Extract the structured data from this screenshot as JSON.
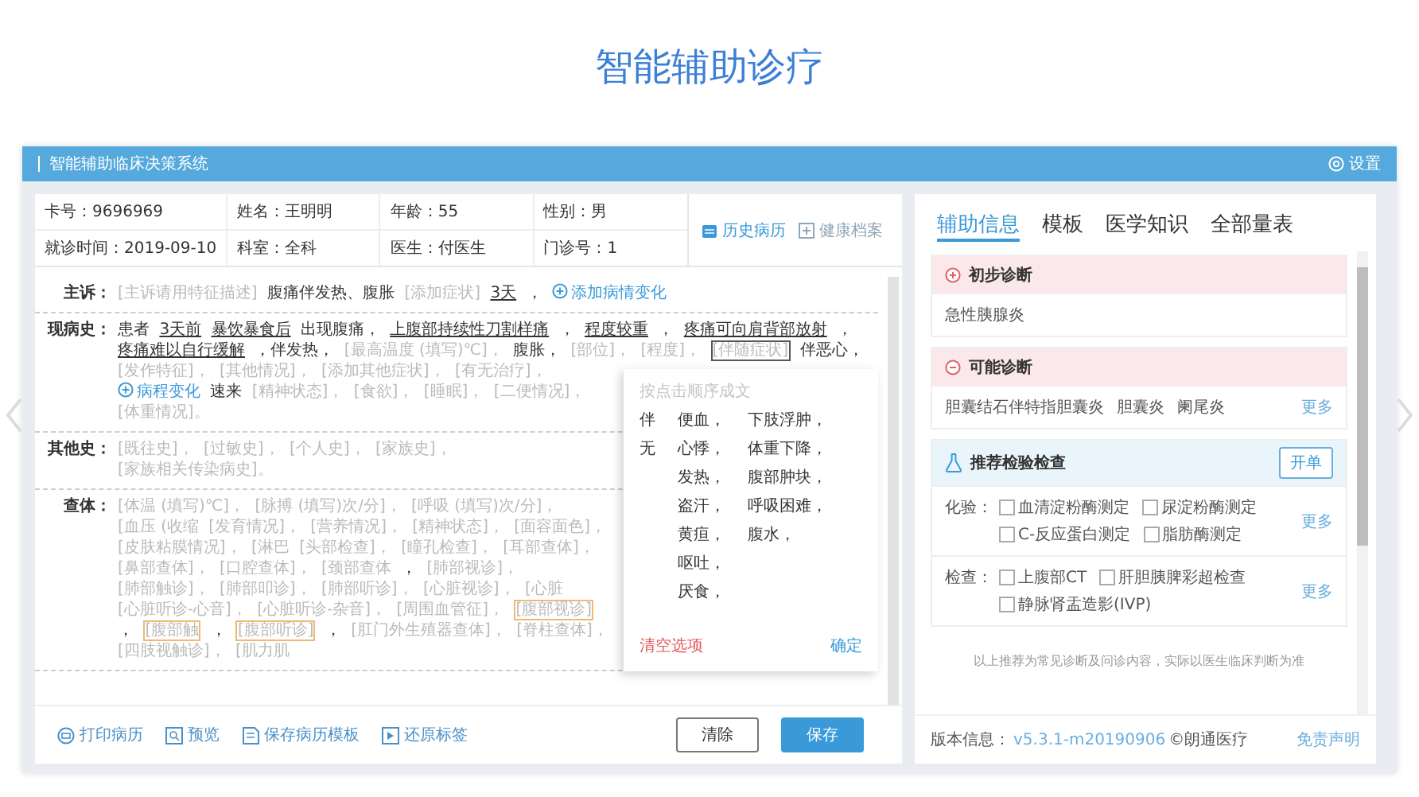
{
  "slide_title": "智能辅助诊疗",
  "app": {
    "title": "智能辅助临床决策系统",
    "settings": "设置"
  },
  "patient_info": [
    {
      "label": "卡号：",
      "value": "9696969"
    },
    {
      "label": "姓名：",
      "value": "王明明"
    },
    {
      "label": "年龄：",
      "value": "55"
    },
    {
      "label": "性别：",
      "value": "男"
    },
    {
      "label": "就诊时间：",
      "value": "2019-09-10"
    },
    {
      "label": "科室：",
      "value": "全科"
    },
    {
      "label": "医生：",
      "value": "付医生"
    },
    {
      "label": "门诊号：",
      "value": "1"
    }
  ],
  "record_actions": [
    {
      "label": "历史病历",
      "disabled": false
    },
    {
      "label": "健康档案",
      "disabled": true
    }
  ],
  "sections": [
    {
      "label": "主诉：",
      "segments": [
        {
          "kind": "placeholder",
          "text": "[主诉请用特征描述]"
        },
        {
          "kind": "text",
          "text": "腹痛伴发热、腹胀"
        },
        {
          "kind": "placeholder",
          "text": "[添加症状]"
        },
        {
          "kind": "underlined",
          "text": "3天"
        },
        {
          "kind": "text",
          "text": "，"
        },
        {
          "kind": "link",
          "text": "添加病情变化"
        }
      ]
    },
    {
      "label": "现病史：",
      "segments": [
        {
          "kind": "text",
          "text": "患者"
        },
        {
          "kind": "underlined",
          "text": "3天前"
        },
        {
          "kind": "underlined",
          "text": "暴饮暴食后"
        },
        {
          "kind": "text",
          "text": "出现腹痛，"
        },
        {
          "kind": "underlined",
          "text": "上腹部持续性刀割样痛"
        },
        {
          "kind": "text",
          "text": "，"
        },
        {
          "kind": "underlined",
          "text": "程度较重"
        },
        {
          "kind": "text",
          "text": "，"
        },
        {
          "kind": "underlined",
          "text": "疼痛可向肩背部放射"
        },
        {
          "kind": "text",
          "text": "，"
        },
        {
          "kind": "underlined",
          "text": "疼痛难以自行缓解"
        },
        {
          "kind": "text",
          "text": "，伴发热，"
        },
        {
          "kind": "placeholder",
          "text": "[最高温度 (填写)℃]，"
        },
        {
          "kind": "text",
          "text": "腹胀，"
        },
        {
          "kind": "placeholder",
          "text": "[部位]，"
        },
        {
          "kind": "placeholder",
          "text": "[程度]，"
        },
        {
          "kind": "focused",
          "text": "[伴随症状]"
        },
        {
          "kind": "text",
          "text": "伴恶心，"
        },
        {
          "kind": "placeholder",
          "text": "[发作特征]，"
        },
        {
          "kind": "placeholder",
          "text": "[其他情况]，"
        },
        {
          "kind": "placeholder",
          "text": "[添加其他症状]，"
        },
        {
          "kind": "placeholder",
          "text": "[有无治疗]，"
        },
        {
          "kind": "link",
          "text": "病程变化"
        },
        {
          "kind": "text",
          "text": "速来"
        },
        {
          "kind": "placeholder",
          "text": "[精神状态]，"
        },
        {
          "kind": "placeholder",
          "text": "[食欲]，"
        },
        {
          "kind": "placeholder",
          "text": "[睡眠]，"
        },
        {
          "kind": "placeholder",
          "text": "[二便情况]，"
        },
        {
          "kind": "placeholder",
          "text": "[体重情况]。"
        }
      ]
    },
    {
      "label": "其他史：",
      "segments": [
        {
          "kind": "placeholder",
          "text": "[既往史]，"
        },
        {
          "kind": "placeholder",
          "text": "[过敏史]，"
        },
        {
          "kind": "placeholder",
          "text": "[个人史]，"
        },
        {
          "kind": "placeholder",
          "text": "[家族史]，"
        },
        {
          "kind": "placeholder",
          "text": "[家族相关传染病史]。"
        }
      ]
    },
    {
      "label": "查体：",
      "segments": [
        {
          "kind": "placeholder",
          "text": "[体温 (填写)℃]，"
        },
        {
          "kind": "placeholder",
          "text": "[脉搏 (填写)次/分]，"
        },
        {
          "kind": "placeholder",
          "text": "[呼吸 (填写)次/分]，"
        },
        {
          "kind": "placeholder",
          "text": "[血压 (收缩"
        },
        {
          "kind": "placeholder",
          "text": "[发育情况]，"
        },
        {
          "kind": "placeholder",
          "text": "[营养情况]，"
        },
        {
          "kind": "placeholder",
          "text": "[精神状态]，"
        },
        {
          "kind": "placeholder",
          "text": "[面容面色]，"
        },
        {
          "kind": "placeholder",
          "text": "[皮肤粘膜情况]，"
        },
        {
          "kind": "placeholder",
          "text": "[淋巴"
        },
        {
          "kind": "placeholder",
          "text": "[头部检查]，"
        },
        {
          "kind": "placeholder",
          "text": "[瞳孔检查]，"
        },
        {
          "kind": "placeholder",
          "text": "[耳部查体]，"
        },
        {
          "kind": "placeholder",
          "text": "[鼻部查体]，"
        },
        {
          "kind": "placeholder",
          "text": "[口腔查体]，"
        },
        {
          "kind": "placeholder",
          "text": "[颈部查体"
        },
        {
          "kind": "text",
          "text": "，"
        },
        {
          "kind": "placeholder",
          "text": "[肺部视诊]，"
        },
        {
          "kind": "placeholder",
          "text": "[肺部触诊]，"
        },
        {
          "kind": "placeholder",
          "text": "[肺部叩诊]，"
        },
        {
          "kind": "placeholder",
          "text": "[肺部听诊]，"
        },
        {
          "kind": "placeholder",
          "text": "[心脏视诊]，"
        },
        {
          "kind": "placeholder",
          "text": "[心脏"
        },
        {
          "kind": "placeholder",
          "text": "[心脏听诊-心音]，"
        },
        {
          "kind": "placeholder",
          "text": "[心脏听诊-杂音]，"
        },
        {
          "kind": "placeholder",
          "text": "[周围血管征]，"
        },
        {
          "kind": "boxed",
          "text": "[腹部视诊]"
        },
        {
          "kind": "text",
          "text": "，"
        },
        {
          "kind": "boxed",
          "text": "[腹部触"
        },
        {
          "kind": "text",
          "text": "，"
        },
        {
          "kind": "boxed",
          "text": "[腹部听诊]"
        },
        {
          "kind": "text",
          "text": "，"
        },
        {
          "kind": "placeholder",
          "text": "[肛门外生殖器查体]，"
        },
        {
          "kind": "placeholder",
          "text": "[脊柱查体]，"
        },
        {
          "kind": "placeholder",
          "text": "[四肢视触诊]，"
        },
        {
          "kind": "placeholder",
          "text": "[肌力肌"
        }
      ]
    }
  ],
  "option_popup": {
    "hint": "按点击顺序成文",
    "columns": [
      [
        "伴",
        "无"
      ],
      [
        "便血，",
        "心悸，",
        "发热，",
        "盗汗，",
        "黄疸，",
        "呕吐，",
        "厌食，"
      ],
      [
        "下肢浮肿，",
        "体重下降，",
        "腹部肿块，",
        "呼吸困难，",
        "腹水，"
      ]
    ],
    "clear": "清空选项",
    "confirm": "确定"
  },
  "toolbar": [
    {
      "kind": "print",
      "label": "打印病历"
    },
    {
      "kind": "preview",
      "label": "预览"
    },
    {
      "kind": "template",
      "label": "保存病历模板"
    },
    {
      "kind": "restore",
      "label": "还原标签"
    }
  ],
  "buttons": [
    {
      "kind": "secondary",
      "label": "清除"
    },
    {
      "kind": "primary",
      "label": "保存"
    }
  ],
  "side_tabs": [
    {
      "label": "辅助信息",
      "selected": true
    },
    {
      "label": "模板",
      "selected": false
    },
    {
      "label": "医学知识",
      "selected": false
    },
    {
      "label": "全部量表",
      "selected": false
    }
  ],
  "diagnosis_sections": [
    {
      "kind": "preliminary",
      "title": "初步诊断",
      "items": [
        "急性胰腺炎"
      ]
    },
    {
      "kind": "possible",
      "title": "可能诊断",
      "items": [
        "胆囊结石伴特指胆囊炎",
        "胆囊炎",
        "阑尾炎"
      ],
      "more": "更多"
    }
  ],
  "recommend": {
    "title": "推荐检验检查",
    "order_button": "开单",
    "groups": [
      {
        "label": "化验：",
        "items": [
          {
            "label": "血清淀粉酶测定",
            "checked": false
          },
          {
            "label": "尿淀粉酶测定",
            "checked": false
          },
          {
            "label": "C-反应蛋白测定",
            "checked": false
          },
          {
            "label": "脂肪酶测定",
            "checked": false
          }
        ],
        "more": "更多"
      },
      {
        "label": "检查：",
        "items": [
          {
            "label": "上腹部CT",
            "checked": false
          },
          {
            "label": "肝胆胰脾彩超检查",
            "checked": false
          },
          {
            "label": "静脉肾盂造影(IVP)",
            "checked": false
          }
        ],
        "more": "更多"
      }
    ]
  },
  "note": "以上推荐为常见诊断及问诊内容，实际以医生临床判断为准",
  "footer": {
    "version_label": "版本信息：",
    "version": "v5.3.1-m20190906",
    "brand": "©朗通医疗",
    "disclaimer": "免责声明"
  }
}
